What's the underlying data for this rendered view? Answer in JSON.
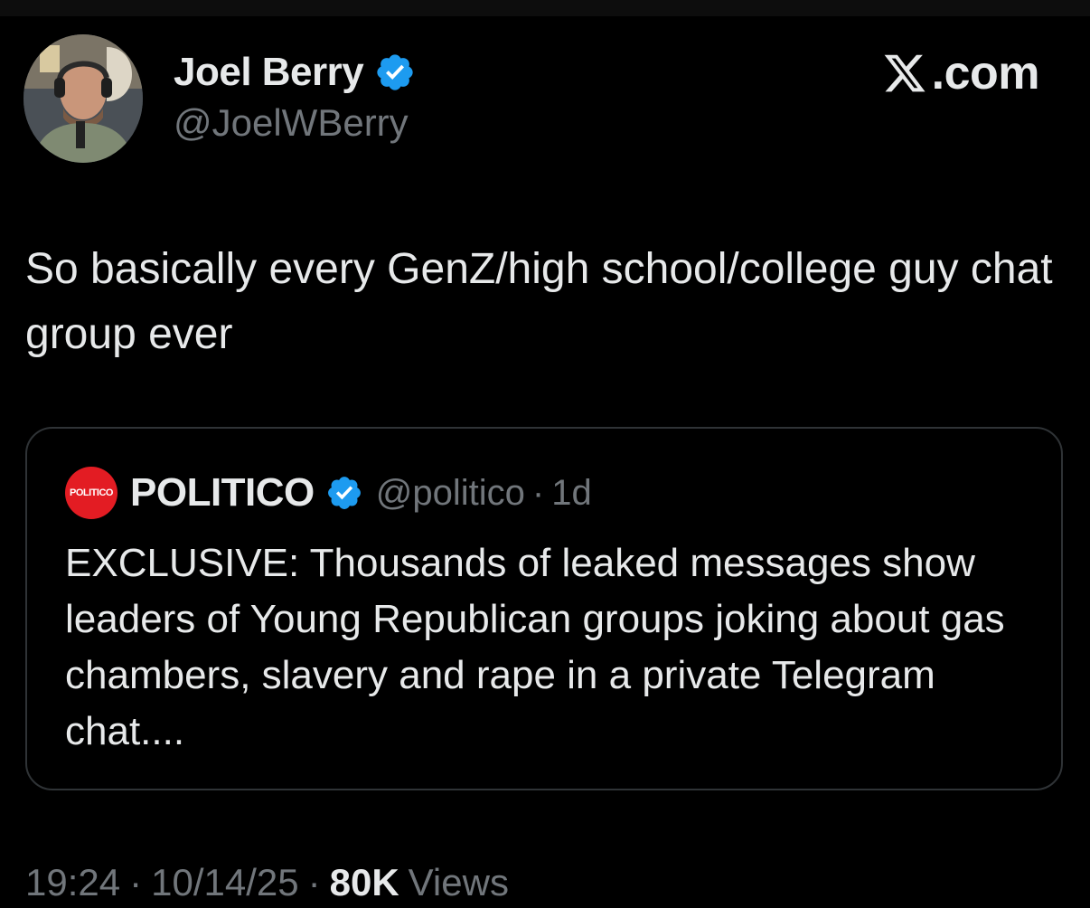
{
  "author": {
    "name": "Joel Berry",
    "handle": "@JoelWBerry",
    "verified_icon": "verified-badge-icon",
    "avatar_icon": "avatar-photo"
  },
  "brand": {
    "label": ".com",
    "icon": "x-logo-icon"
  },
  "tweet": {
    "text": "So basically every GenZ/high school/college guy chat group ever"
  },
  "quote": {
    "logo_text": "POLITICO",
    "name": "POLITICO",
    "handle": "@politico",
    "separator": "·",
    "time": "1d",
    "text": "EXCLUSIVE: Thousands of leaked messages show leaders of Young Republican groups joking about gas chambers, slavery and rape in a private Telegram chat...."
  },
  "meta": {
    "time": "19:24",
    "separator": "·",
    "date": "10/14/25",
    "views_count": "80K",
    "views_label": "Views"
  },
  "colors": {
    "background": "#000000",
    "text": "#e7e9ea",
    "muted": "#71767b",
    "verified": "#1d9bf0",
    "politico_red": "#e31c23",
    "border": "#2f3336"
  }
}
